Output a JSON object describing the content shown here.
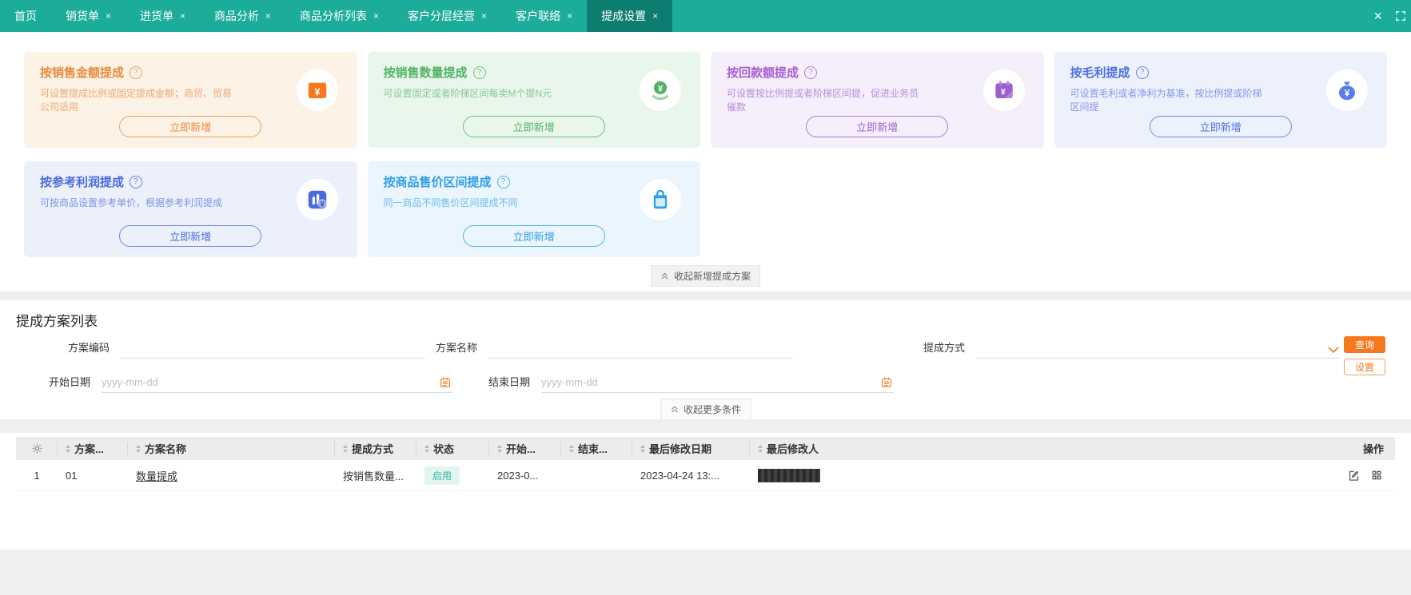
{
  "topbar": {
    "tabs": [
      {
        "label": "首页",
        "closable": false,
        "active": false
      },
      {
        "label": "销货单",
        "closable": true,
        "active": false
      },
      {
        "label": "进货单",
        "closable": true,
        "active": false
      },
      {
        "label": "商品分析",
        "closable": true,
        "active": false
      },
      {
        "label": "商品分析列表",
        "closable": true,
        "active": false
      },
      {
        "label": "客户分层经营",
        "closable": true,
        "active": false
      },
      {
        "label": "客户联络",
        "closable": true,
        "active": false
      },
      {
        "label": "提成设置",
        "closable": true,
        "active": true
      }
    ],
    "tab_close_glyph": "×",
    "close_all_glyph": "×"
  },
  "cards": {
    "help_glyph": "?",
    "collapse_label": "收起新增提成方案",
    "items": [
      {
        "title": "按销售金额提成",
        "desc": "可设置提成比例或固定提成金额；商贸、贸易公司适用",
        "button": "立即新增",
        "icon": "wallet-icon",
        "accent": "#E98A3E",
        "bg": "#FDF2E6"
      },
      {
        "title": "按销售数量提成",
        "desc": "可设置固定或者阶梯区间每卖M个提N元",
        "button": "立即新增",
        "icon": "coin-deposit-icon",
        "accent": "#4FB464",
        "bg": "#E9F6EC"
      },
      {
        "title": "按回款额提成",
        "desc": "可设置按比例提或者阶梯区间提，促进业务员催款",
        "button": "立即新增",
        "icon": "calendar-money-icon",
        "accent": "#A55FD6",
        "bg": "#F4EFFA"
      },
      {
        "title": "按毛利提成",
        "desc": "可设置毛利或者净利为基准，按比例提或阶梯区间提",
        "button": "立即新增",
        "icon": "money-bag-icon",
        "accent": "#4E6EE4",
        "bg": "#EDF1FC"
      },
      {
        "title": "按参考利润提成",
        "desc": "可按商品设置参考单价，根据参考利润提成",
        "button": "立即新增",
        "icon": "chart-coin-icon",
        "accent": "#4A6BE0",
        "bg": "#ECF0FB"
      },
      {
        "title": "按商品售价区间提成",
        "desc": "同一商品不同售价区间提成不同",
        "button": "立即新增",
        "icon": "shopping-bag-icon",
        "accent": "#2F9FE9",
        "bg": "#EAF5FD"
      }
    ]
  },
  "list_section": {
    "title": "提成方案列表",
    "filters": {
      "code_label": "方案编码",
      "name_label": "方案名称",
      "method_label": "提成方式",
      "start_label": "开始日期",
      "end_label": "结束日期",
      "date_placeholder": "yyyy-mm-dd"
    },
    "query_button": "查询",
    "settings_button": "设置",
    "collapse_label": "收起更多条件"
  },
  "table": {
    "headers": [
      {
        "label": "方案..."
      },
      {
        "label": "方案名称"
      },
      {
        "label": "提成方式"
      },
      {
        "label": "状态"
      },
      {
        "label": "开始..."
      },
      {
        "label": "结束..."
      },
      {
        "label": "最后修改日期"
      },
      {
        "label": "最后修改人"
      }
    ],
    "action_header": "操作",
    "rows": [
      {
        "index": "1",
        "code": "01",
        "name": "数量提成",
        "method": "按销售数量...",
        "status": "启用",
        "start": "2023-0...",
        "end": "",
        "modified_date": "2023-04-24 13:...",
        "modifier_censored": true
      }
    ]
  },
  "colors": {
    "topbar": "#1CAC9A",
    "topbar_active_tab": "#0D7D70",
    "accent_orange": "#F5781E",
    "status_enabled_text": "#2FB3A0",
    "status_enabled_bg": "#E3F5F1"
  }
}
